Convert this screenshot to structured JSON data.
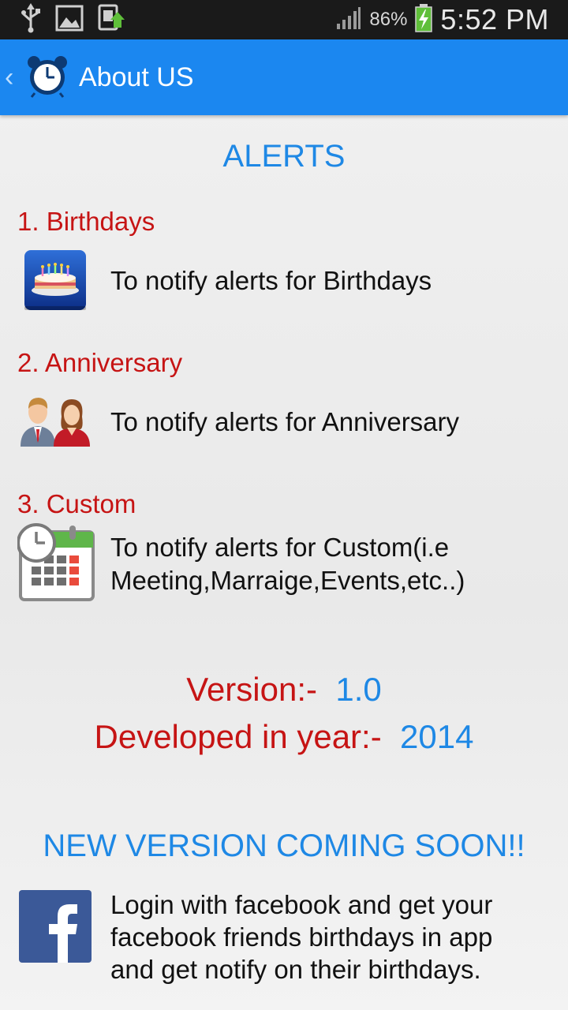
{
  "status_bar": {
    "battery_percent": "86%",
    "time": "5:52 PM",
    "icons": [
      "usb-icon",
      "image-icon",
      "screenshot-icon",
      "signal-icon",
      "battery-charging-icon"
    ]
  },
  "app_bar": {
    "title": "About US",
    "color": "#1b87f0"
  },
  "section_title": "ALERTS",
  "alerts": [
    {
      "title": "1. Birthdays",
      "text": "To notify alerts for Birthdays",
      "icon": "birthday-cake-icon"
    },
    {
      "title": "2. Anniversary",
      "text": "To notify alerts for Anniversary",
      "icon": "couple-icon"
    },
    {
      "title": "3. Custom",
      "text_line1": "To notify alerts for Custom(i.e",
      "text_line2": "Meeting,Marraige,Events,etc..)",
      "icon": "calendar-clock-icon"
    }
  ],
  "version": {
    "label": "Version:-",
    "value": "1.0"
  },
  "developed": {
    "label": "Developed in year:-",
    "value": "2014"
  },
  "coming_soon": "NEW VERSION COMING SOON!!",
  "facebook": {
    "icon": "facebook-icon",
    "line1": "Login with facebook and get your",
    "line2": "facebook friends birthdays in app",
    "line3": "and get notify on their birthdays."
  },
  "colors": {
    "accent_blue": "#1e88e5",
    "accent_red": "#c61414",
    "facebook_blue": "#3b5998"
  }
}
